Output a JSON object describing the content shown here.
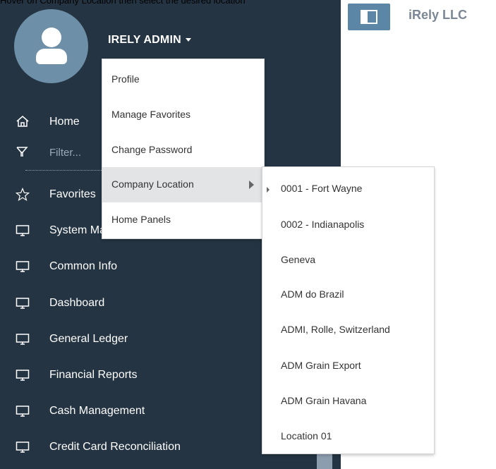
{
  "caption": "Hover on Company Location then select the desired location",
  "header": {
    "company_name": "iRely LLC",
    "toggle_icon": "sidebar-toggle-icon"
  },
  "user": {
    "name": "IRELY ADMIN",
    "avatar_icon": "user-avatar-icon"
  },
  "sidebar": {
    "home_label": "Home",
    "filter_placeholder": "Filter...",
    "items": [
      {
        "label": "Favorites",
        "icon": "star-icon"
      },
      {
        "label": "System Manager",
        "icon": "monitor-icon"
      },
      {
        "label": "Common Info",
        "icon": "monitor-icon"
      },
      {
        "label": "Dashboard",
        "icon": "monitor-icon"
      },
      {
        "label": "General Ledger",
        "icon": "monitor-icon"
      },
      {
        "label": "Financial Reports",
        "icon": "monitor-icon"
      },
      {
        "label": "Cash Management",
        "icon": "monitor-icon"
      },
      {
        "label": "Credit Card Reconciliation",
        "icon": "monitor-icon"
      }
    ]
  },
  "user_menu": {
    "items": [
      "Profile",
      "Manage Favorites",
      "Change Password",
      "Company Location",
      "Home Panels"
    ],
    "active_index": 3
  },
  "location_menu": {
    "items": [
      "0001 - Fort Wayne",
      "0002 - Indianapolis",
      "Geneva",
      "ADM do Brazil",
      "ADMI, Rolle, Switzerland",
      "ADM Grain Export",
      "ADM Grain Havana",
      "Location 01"
    ],
    "hovered_index": 0
  },
  "colors": {
    "sidebar_bg": "#243443",
    "accent": "#5b86a6",
    "menu_hover": "#e2e4e6"
  }
}
